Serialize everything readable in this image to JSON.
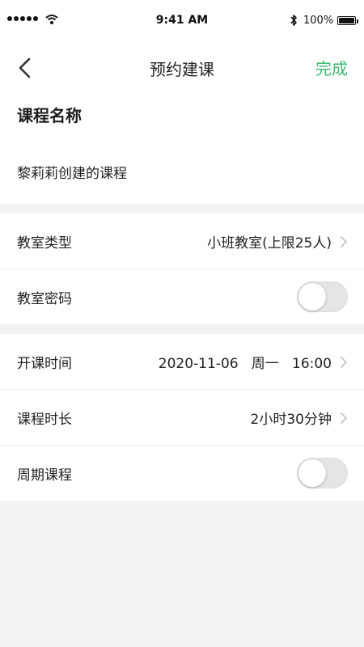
{
  "status_bar": {
    "time": "9:41 AM",
    "battery": "100%",
    "signal_icon": "signal-dots-icon",
    "wifi_icon": "wifi-icon",
    "bluetooth_icon": "bluetooth-icon",
    "battery_level": 1.0
  },
  "nav": {
    "title": "预约建课",
    "done_label": "完成",
    "back_icon": "chevron-left-icon",
    "accent_color": "#3db96f"
  },
  "course": {
    "heading": "课程名称",
    "name_value": "黎莉莉创建的课程"
  },
  "classroom": {
    "type_label": "教室类型",
    "type_value": "小班教室(上限25人)",
    "password_label": "教室密码",
    "password_enabled": false
  },
  "schedule": {
    "start_label": "开课时间",
    "start_value": "2020-11-06   周一   16:00",
    "duration_label": "课程时长",
    "duration_value": "2小时30分钟",
    "recurring_label": "周期课程",
    "recurring_enabled": false
  }
}
